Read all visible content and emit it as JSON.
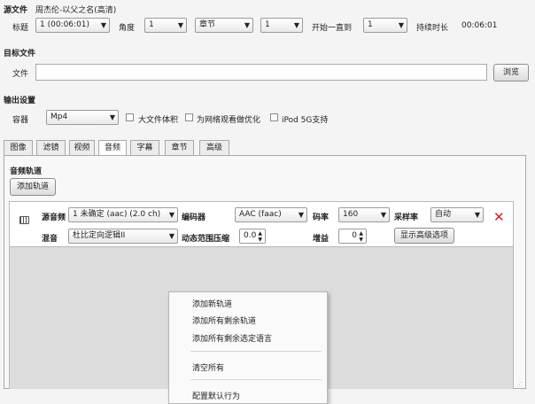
{
  "source": {
    "section_label": "源文件",
    "source_name": "周杰伦-以父之名(高清)",
    "title_label": "标题",
    "title_value": "1 (00:06:01)",
    "angle_label": "角度",
    "angle_value": "1",
    "range_type": "章节",
    "range_start": "1",
    "start_to_label": "开始一直到",
    "range_end": "1",
    "duration_label": "持续时长",
    "duration_value": "00:06:01"
  },
  "destination": {
    "section_label": "目标文件",
    "file_label": "文件",
    "file_value": "",
    "browse_label": "浏览"
  },
  "output": {
    "section_label": "输出设置",
    "container_label": "容器",
    "container_value": "Mp4",
    "large_file_label": "大文件体积",
    "web_optimized_label": "为网络观看做优化",
    "ipod_label": "iPod 5G支持"
  },
  "tabs": [
    {
      "label": "图像"
    },
    {
      "label": "滤镜"
    },
    {
      "label": "视频"
    },
    {
      "label": "音频"
    },
    {
      "label": "字幕"
    },
    {
      "label": "章节"
    },
    {
      "label": "高级"
    }
  ],
  "active_tab": "音频",
  "audio": {
    "section_label": "音频轨道",
    "add_track_label": "添加轨道",
    "track": {
      "source_label": "源音频",
      "source_value": "1 未确定 (aac) (2.0 ch)",
      "encoder_label": "编码器",
      "encoder_value": "AAC (faac)",
      "bitrate_label": "码率",
      "bitrate_value": "160",
      "samplerate_label": "采样率",
      "samplerate_value": "自动",
      "mix_label": "混音",
      "mix_value": "杜比定向逻辑II",
      "drc_label": "动态范围压缩",
      "drc_value": "0.0",
      "gain_label": "增益",
      "gain_value": "0",
      "advanced_label": "显示高级选项"
    }
  },
  "context_menu": {
    "items": [
      {
        "label": "添加新轨道"
      },
      {
        "label": "添加所有剩余轨道"
      },
      {
        "label": "添加所有剩余选定语言"
      },
      {
        "label": "清空所有"
      },
      {
        "label": "配置默认行为"
      }
    ]
  },
  "colors": {
    "delete_icon": "#d62020",
    "window_bg": "#f4f4f4"
  }
}
